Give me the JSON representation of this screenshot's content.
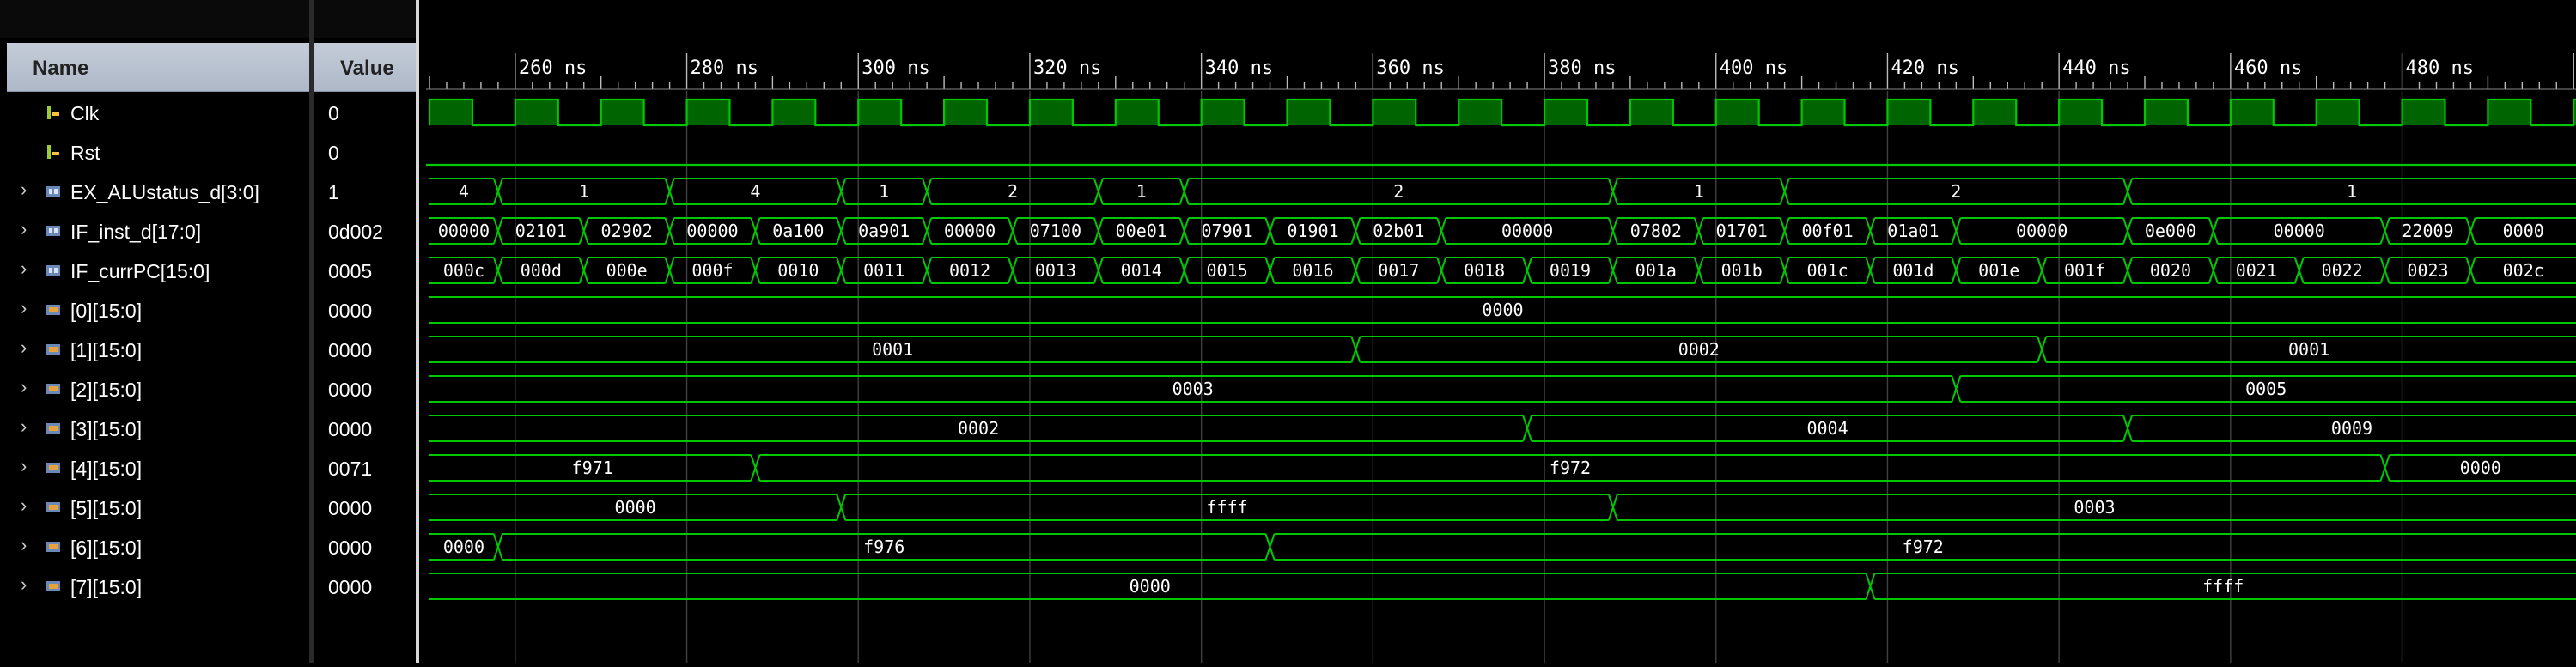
{
  "columns": {
    "name": "Name",
    "value": "Value"
  },
  "colors": {
    "wave": "#00c800",
    "clock_fill": "#006400",
    "text": "#ffffff",
    "grid": "#404040"
  },
  "timeline": {
    "unit": "ns",
    "ticks": [
      {
        "t": 260,
        "label": "260 ns"
      },
      {
        "t": 280,
        "label": "280 ns"
      },
      {
        "t": 300,
        "label": "300 ns"
      },
      {
        "t": 320,
        "label": "320 ns"
      },
      {
        "t": 340,
        "label": "340 ns"
      },
      {
        "t": 360,
        "label": "360 ns"
      },
      {
        "t": 380,
        "label": "380 ns"
      },
      {
        "t": 400,
        "label": "400 ns"
      },
      {
        "t": 420,
        "label": "420 ns"
      },
      {
        "t": 440,
        "label": "440 ns"
      },
      {
        "t": 460,
        "label": "460 ns"
      },
      {
        "t": 480,
        "label": "480 ns"
      }
    ]
  },
  "signals": [
    {
      "name": "Clk",
      "value": "0",
      "kind": "bit",
      "expandable": false,
      "icon": "bit-signal-icon",
      "clock": {
        "period": 10,
        "first_rise": 250
      }
    },
    {
      "name": "Rst",
      "value": "0",
      "kind": "bit",
      "expandable": false,
      "icon": "bit-signal-icon",
      "level": 0
    },
    {
      "name": "EX_ALUstatus_d[3:0]",
      "value": "1",
      "kind": "bus",
      "expandable": true,
      "icon": "bus-signal-icon",
      "segments": [
        {
          "t": 250,
          "v": "4"
        },
        {
          "t": 258,
          "v": "1"
        },
        {
          "t": 278,
          "v": "4"
        },
        {
          "t": 298,
          "v": "1"
        },
        {
          "t": 308,
          "v": "2"
        },
        {
          "t": 328,
          "v": "1"
        },
        {
          "t": 338,
          "v": "2"
        },
        {
          "t": 388,
          "v": "1"
        },
        {
          "t": 408,
          "v": "2"
        },
        {
          "t": 448,
          "v": "1"
        }
      ]
    },
    {
      "name": "IF_inst_d[17:0]",
      "value": "0d002",
      "kind": "bus",
      "expandable": true,
      "icon": "bus-signal-icon",
      "segments": [
        {
          "t": 250,
          "v": "00000"
        },
        {
          "t": 258,
          "v": "02101"
        },
        {
          "t": 268,
          "v": "02902"
        },
        {
          "t": 278,
          "v": "00000"
        },
        {
          "t": 288,
          "v": "0a100"
        },
        {
          "t": 298,
          "v": "0a901"
        },
        {
          "t": 308,
          "v": "00000"
        },
        {
          "t": 318,
          "v": "07100"
        },
        {
          "t": 328,
          "v": "00e01"
        },
        {
          "t": 338,
          "v": "07901"
        },
        {
          "t": 348,
          "v": "01901"
        },
        {
          "t": 358,
          "v": "02b01"
        },
        {
          "t": 368,
          "v": "00000"
        },
        {
          "t": 388,
          "v": "07802"
        },
        {
          "t": 398,
          "v": "01701"
        },
        {
          "t": 408,
          "v": "00f01"
        },
        {
          "t": 418,
          "v": "01a01"
        },
        {
          "t": 428,
          "v": "00000"
        },
        {
          "t": 448,
          "v": "0e000"
        },
        {
          "t": 458,
          "v": "00000"
        },
        {
          "t": 478,
          "v": "22009"
        },
        {
          "t": 488,
          "v": "0000"
        }
      ]
    },
    {
      "name": "IF_currPC[15:0]",
      "value": "0005",
      "kind": "bus",
      "expandable": true,
      "icon": "bus-signal-icon",
      "segments": [
        {
          "t": 250,
          "v": "000c"
        },
        {
          "t": 258,
          "v": "000d"
        },
        {
          "t": 268,
          "v": "000e"
        },
        {
          "t": 278,
          "v": "000f"
        },
        {
          "t": 288,
          "v": "0010"
        },
        {
          "t": 298,
          "v": "0011"
        },
        {
          "t": 308,
          "v": "0012"
        },
        {
          "t": 318,
          "v": "0013"
        },
        {
          "t": 328,
          "v": "0014"
        },
        {
          "t": 338,
          "v": "0015"
        },
        {
          "t": 348,
          "v": "0016"
        },
        {
          "t": 358,
          "v": "0017"
        },
        {
          "t": 368,
          "v": "0018"
        },
        {
          "t": 378,
          "v": "0019"
        },
        {
          "t": 388,
          "v": "001a"
        },
        {
          "t": 398,
          "v": "001b"
        },
        {
          "t": 408,
          "v": "001c"
        },
        {
          "t": 418,
          "v": "001d"
        },
        {
          "t": 428,
          "v": "001e"
        },
        {
          "t": 438,
          "v": "001f"
        },
        {
          "t": 448,
          "v": "0020"
        },
        {
          "t": 458,
          "v": "0021"
        },
        {
          "t": 468,
          "v": "0022"
        },
        {
          "t": 478,
          "v": "0023"
        },
        {
          "t": 488,
          "v": "002c"
        }
      ]
    },
    {
      "name": "[0][15:0]",
      "value": "0000",
      "kind": "bus",
      "expandable": true,
      "icon": "array-signal-icon",
      "segments": [
        {
          "t": 250,
          "v": "0000"
        }
      ]
    },
    {
      "name": "[1][15:0]",
      "value": "0000",
      "kind": "bus",
      "expandable": true,
      "icon": "array-signal-icon",
      "segments": [
        {
          "t": 250,
          "v": "0001"
        },
        {
          "t": 358,
          "v": "0002"
        },
        {
          "t": 438,
          "v": "0001"
        }
      ]
    },
    {
      "name": "[2][15:0]",
      "value": "0000",
      "kind": "bus",
      "expandable": true,
      "icon": "array-signal-icon",
      "segments": [
        {
          "t": 250,
          "v": "0003"
        },
        {
          "t": 428,
          "v": "0005"
        }
      ]
    },
    {
      "name": "[3][15:0]",
      "value": "0000",
      "kind": "bus",
      "expandable": true,
      "icon": "array-signal-icon",
      "segments": [
        {
          "t": 250,
          "v": "0002"
        },
        {
          "t": 378,
          "v": "0004"
        },
        {
          "t": 448,
          "v": "0009"
        }
      ]
    },
    {
      "name": "[4][15:0]",
      "value": "0071",
      "kind": "bus",
      "expandable": true,
      "icon": "array-signal-icon",
      "segments": [
        {
          "t": 250,
          "v": "f971"
        },
        {
          "t": 288,
          "v": "f972"
        },
        {
          "t": 478,
          "v": "0000"
        }
      ]
    },
    {
      "name": "[5][15:0]",
      "value": "0000",
      "kind": "bus",
      "expandable": true,
      "icon": "array-signal-icon",
      "segments": [
        {
          "t": 250,
          "v": "0000"
        },
        {
          "t": 298,
          "v": "ffff"
        },
        {
          "t": 388,
          "v": "0003"
        }
      ]
    },
    {
      "name": "[6][15:0]",
      "value": "0000",
      "kind": "bus",
      "expandable": true,
      "icon": "array-signal-icon",
      "segments": [
        {
          "t": 250,
          "v": "0000"
        },
        {
          "t": 258,
          "v": "f976"
        },
        {
          "t": 348,
          "v": "f972"
        }
      ]
    },
    {
      "name": "[7][15:0]",
      "value": "0000",
      "kind": "bus",
      "expandable": true,
      "icon": "array-signal-icon",
      "segments": [
        {
          "t": 250,
          "v": "0000"
        },
        {
          "t": 418,
          "v": "ffff"
        }
      ]
    }
  ]
}
